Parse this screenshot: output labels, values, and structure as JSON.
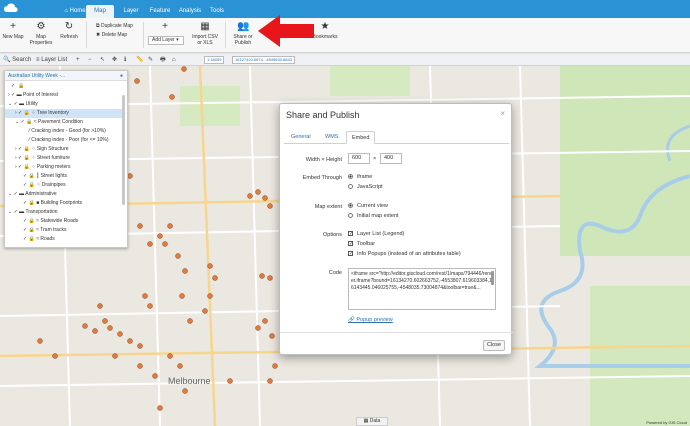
{
  "app": {
    "tabs": [
      "Home",
      "Map",
      "Layer",
      "Feature",
      "Analysis",
      "Tools"
    ],
    "active_tab": "Map"
  },
  "ribbon": {
    "new_map": "New Map",
    "map_properties": "Map Properties",
    "refresh": "Refresh",
    "duplicate_map": "Duplicate Map",
    "delete_map": "Delete Map",
    "add_layer": "Add Layer",
    "import_csv": "Import CSV or XLS",
    "share_publish": "Share or Publish",
    "bookmarks": "Bookmarks"
  },
  "toolbar": {
    "search": "Search",
    "layer_list": "Layer List",
    "scale": "1:18059",
    "coords": "16127420.6674, -4549630.6843"
  },
  "layer_panel": {
    "title": "Australian Utility Week -...",
    "items": [
      {
        "label": "Point of Interest"
      },
      {
        "label": "Utility"
      },
      {
        "label": "Tree Inventory"
      },
      {
        "label": "Pavement Condition"
      },
      {
        "label": "Cracking index - Good (for >10%)"
      },
      {
        "label": "Cracking index - Poor (for <= 10%)"
      },
      {
        "label": "Sign Structure"
      },
      {
        "label": "Street furniture"
      },
      {
        "label": "Parking meters"
      },
      {
        "label": "Street lights"
      },
      {
        "label": "Drainpipes"
      },
      {
        "label": "Administrative"
      },
      {
        "label": "Building Footprints"
      },
      {
        "label": "Transportation"
      },
      {
        "label": "Statewide Roads"
      },
      {
        "label": "Tram tracks"
      },
      {
        "label": "Roads"
      }
    ]
  },
  "modal": {
    "title": "Share and Publish",
    "close_x": "×",
    "tabs": [
      "General",
      "WMS",
      "Embed"
    ],
    "active_tab": "Embed",
    "width_height_label": "Width × Height",
    "width": "600",
    "times": "×",
    "height": "400",
    "embed_through_label": "Embed Through",
    "embed_iframe": "iframe",
    "embed_js": "JavaScript",
    "map_extent_label": "Map extent",
    "extent_current": "Current view",
    "extent_initial": "Initial map extent",
    "options_label": "Options",
    "opt_layer_list": "Layer List (Legend)",
    "opt_toolbar": "Toolbar",
    "opt_info_popups": "Info Popups (instead of an attributes table)",
    "code_label": "Code",
    "code": "<iframe src=\"http://editor.giscloud.com/rest/1/maps/794446/render.iframe?bound=16134270.602663752,-4553807.619603384,16143445.046025755,-4548035.73004874&toolbar=true&...",
    "popup_preview": "Popup preview",
    "close_button": "Close"
  },
  "map": {
    "label_melbourne": "Melbourne",
    "bottom_tab": "Data",
    "powered": "Powered by GIS Cloud"
  },
  "colors": {
    "topbar": "#2a93d5",
    "accent": "#2a6fb0",
    "arrow": "#e8161b",
    "marker": "#e07a3f"
  }
}
